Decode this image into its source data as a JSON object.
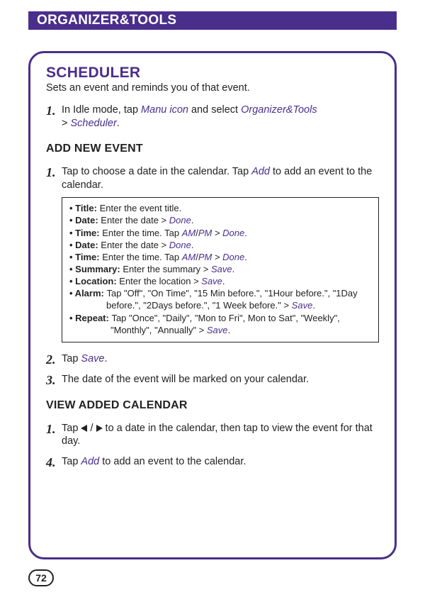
{
  "header": {
    "title": "ORGANIZER&TOOLS"
  },
  "scheduler": {
    "title": "SCHEDULER",
    "subtitle": "Sets an event and reminds you of that event."
  },
  "intro_step": {
    "num": "1.",
    "t1": "In Idle mode, tap ",
    "link1": "Manu icon",
    "t2": " and select ",
    "link2": "Organizer&Tools",
    "gt": " > ",
    "link3": "Scheduler",
    "period": "."
  },
  "add_event": {
    "heading": "ADD NEW EVENT",
    "step1": {
      "num": "1.",
      "t1": "Tap to choose a date in the calendar. Tap ",
      "link": "Add",
      "t2": " to add an event to the calendar."
    },
    "box": {
      "r1": {
        "b": "• Title: ",
        "t": "Enter the event title."
      },
      "r2": {
        "b": "• Date: ",
        "t1": "Enter the date > ",
        "link": "Done",
        "t2": "."
      },
      "r3": {
        "b": "• Time: ",
        "t1": "Enter the time. Tap ",
        "linkA": "AM",
        "slash": "/",
        "linkB": "PM",
        "gt": " > ",
        "linkC": "Done",
        "t2": "."
      },
      "r4": {
        "b": "• Date: ",
        "t1": "Enter the date > ",
        "link": "Done",
        "t2": "."
      },
      "r5": {
        "b": "• Time: ",
        "t1": "Enter the time. Tap ",
        "linkA": "AM",
        "slash": "/",
        "linkB": "PM",
        "gt": " > ",
        "linkC": "Done",
        "t2": "."
      },
      "r6": {
        "b": "• Summary: ",
        "t1": "Enter the summary > ",
        "link": "Save",
        "t2": "."
      },
      "r7": {
        "b": "• Location: ",
        "t1": "Enter the location > ",
        "link": "Save",
        "t2": "."
      },
      "r8a": {
        "b": "• Alarm: ",
        "t": "Tap \"Off\", \"On Time\", \"15 Min  before.\", \"1Hour before.\", \"1Day"
      },
      "r8b": {
        "t1": "before.\", \"2Days before.\", \"1 Week before.\" > ",
        "link": "Save",
        "t2": "."
      },
      "r9a": {
        "b": "• Repeat: ",
        "t": "Tap \"Once\", \"Daily\", \"Mon to Fri\", Mon to Sat\", \"Weekly\","
      },
      "r9b": {
        "t1": "\"Monthly\", \"Annually\" > ",
        "link": "Save",
        "t2": "."
      }
    },
    "step2": {
      "num": "2.",
      "t1": "Tap ",
      "link": "Save",
      "t2": "."
    },
    "step3": {
      "num": "3.",
      "t": "The date of the event will be marked on your calendar."
    }
  },
  "view_cal": {
    "heading": "VIEW ADDED CALENDAR",
    "step1": {
      "num": "1.",
      "t1": "Tap ",
      "slash": " / ",
      "t2": " to a date in the calendar, then tap to view the event for that day."
    },
    "step4": {
      "num": "4.",
      "t1": "Tap ",
      "link": "Add",
      "t2": " to add an event to the calendar."
    }
  },
  "page": "72"
}
